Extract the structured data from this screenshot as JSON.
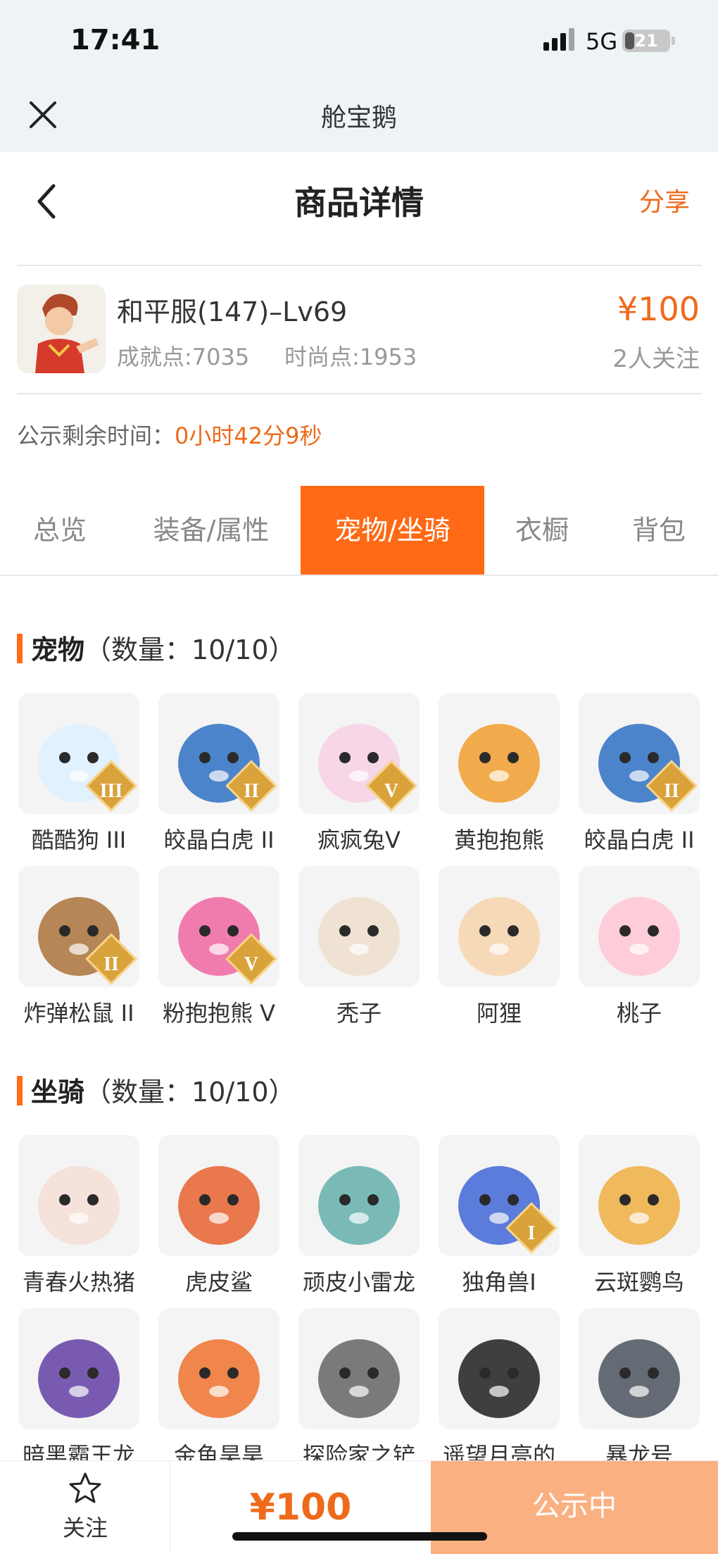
{
  "status_bar": {
    "time": "17:41",
    "network": "5G",
    "battery": "21",
    "battery_level": 0.21
  },
  "app_bar": {
    "title": "舱宝鹅",
    "close_icon": "close-icon"
  },
  "header": {
    "title": "商品详情",
    "share_label": "分享",
    "back_icon": "chevron-left-icon"
  },
  "product": {
    "name": "和平服(147)–Lv69",
    "achievement": "成就点:7035",
    "fashion": "时尚点:1953",
    "price": "¥100",
    "followers": "2人关注"
  },
  "countdown": {
    "label": "公示剩余时间：",
    "value": "0小时42分9秒"
  },
  "tabs": [
    {
      "label": "总览",
      "active": false
    },
    {
      "label": "装备/属性",
      "active": false
    },
    {
      "label": "宠物/坐骑",
      "active": true
    },
    {
      "label": "衣橱",
      "active": false
    },
    {
      "label": "背包",
      "active": false
    }
  ],
  "pets": {
    "title": "宠物",
    "count": "（数量：10/10）",
    "items": [
      {
        "label": "酷酷狗 III",
        "badge": "III"
      },
      {
        "label": "皎晶白虎 II",
        "badge": "II"
      },
      {
        "label": "疯疯兔V",
        "badge": "V"
      },
      {
        "label": "黄抱抱熊",
        "badge": ""
      },
      {
        "label": "皎晶白虎 II",
        "badge": "II"
      },
      {
        "label": "炸弹松鼠 II",
        "badge": "II"
      },
      {
        "label": "粉抱抱熊 V",
        "badge": "V"
      },
      {
        "label": "秃子",
        "badge": ""
      },
      {
        "label": "阿狸",
        "badge": ""
      },
      {
        "label": "桃子",
        "badge": ""
      }
    ]
  },
  "mounts": {
    "title": "坐骑",
    "count": "（数量：10/10）",
    "items": [
      {
        "label": "青春火热猪",
        "badge": ""
      },
      {
        "label": "虎皮鲨",
        "badge": ""
      },
      {
        "label": "顽皮小雷龙",
        "badge": ""
      },
      {
        "label": "独角兽I",
        "badge": "I"
      },
      {
        "label": "云斑鹦鸟",
        "badge": ""
      },
      {
        "label": "暗黑霸王龙",
        "badge": ""
      },
      {
        "label": "金鱼昊昊",
        "badge": ""
      },
      {
        "label": "探险家之铲",
        "badge": ""
      },
      {
        "label": "遥望月亮的",
        "badge": ""
      },
      {
        "label": "暴龙号",
        "badge": ""
      }
    ]
  },
  "bottom_bar": {
    "follow_label": "关注",
    "price": "¥100",
    "status_label": "公示中",
    "follow_icon": "star-icon"
  },
  "colors": {
    "accent": "#fe6a16",
    "price": "#ee6a1a",
    "status_button": "#fbb081",
    "header_bg": "#eef3f6"
  }
}
